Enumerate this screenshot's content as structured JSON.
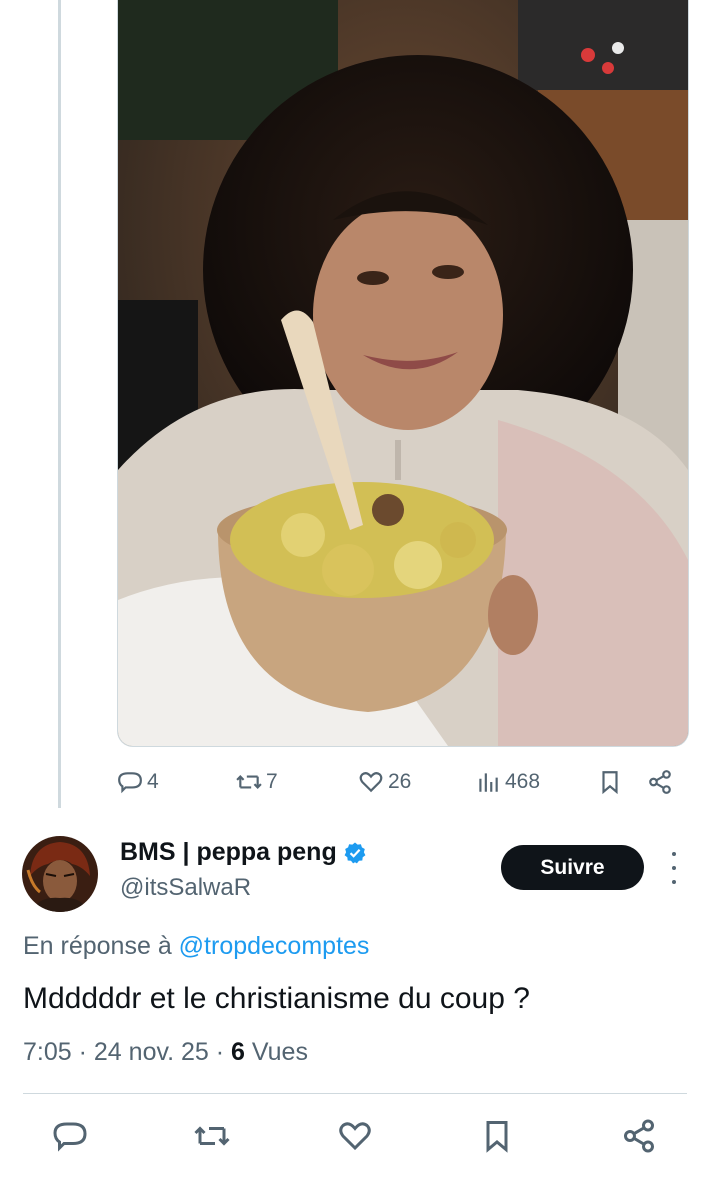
{
  "post": {
    "actions": {
      "replies": "4",
      "reposts": "7",
      "likes": "26",
      "views": "468"
    }
  },
  "reply": {
    "display_name": "BMS | peppa peng",
    "handle": "@itsSalwaR",
    "follow_label": "Suivre",
    "reply_prefix": "En réponse à",
    "reply_mention": "@tropdecomptes",
    "text": "Mdddddr et le christianisme du coup ?",
    "time": "7:05",
    "date": "24 nov. 25",
    "views_count": "6",
    "views_label": "Vues"
  },
  "colors": {
    "accent": "#1d9bf0",
    "text_primary": "#0f1419",
    "text_secondary": "#536471",
    "button_bg": "#0f1419"
  }
}
